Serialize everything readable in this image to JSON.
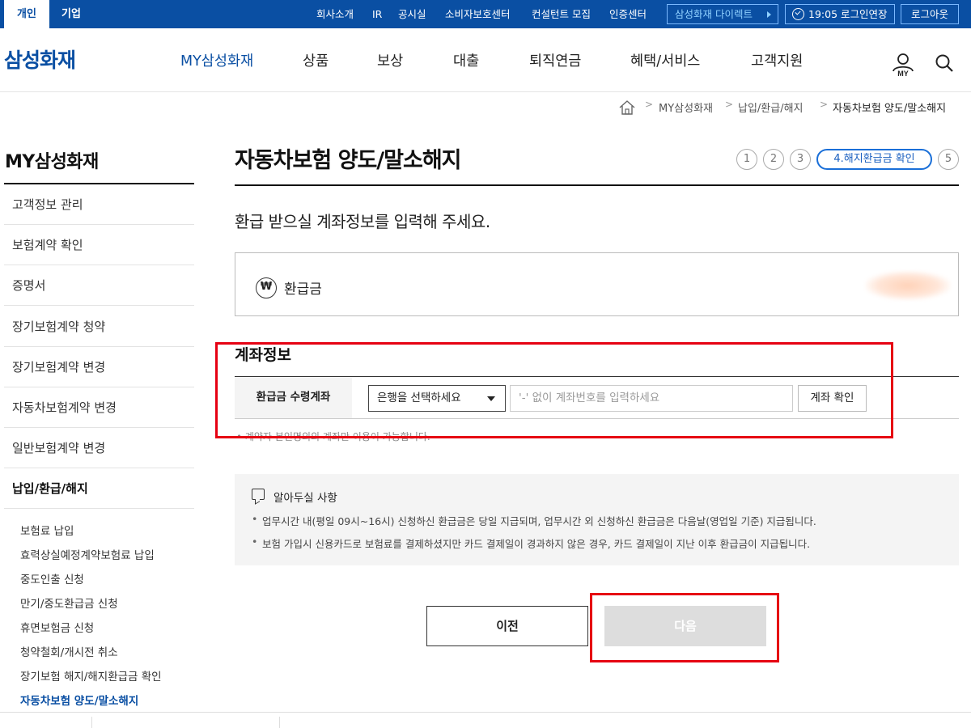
{
  "topbar": {
    "tab_personal": "개인",
    "tab_corporate": "기업",
    "links": [
      "회사소개",
      "IR",
      "공시실",
      "소비자보호센터",
      "컨설턴트 모집",
      "인증센터"
    ],
    "direct_button": "삼성화재 다이렉트",
    "login_extend": "19:05 로그인연장",
    "logout": "로그아웃"
  },
  "header": {
    "logo": "삼성화재",
    "menu": [
      "MY삼성화재",
      "상품",
      "보상",
      "대출",
      "퇴직연금",
      "혜택/서비스",
      "고객지원"
    ],
    "my_icon_label": "MY"
  },
  "breadcrumb": [
    "MY삼성화재",
    "납입/환급/해지",
    "자동차보험 양도/말소해지"
  ],
  "sidebar": {
    "title": "MY삼성화재",
    "items": [
      "고객정보 관리",
      "보험계약 확인",
      "증명서",
      "장기보험계약 청약",
      "장기보험계약 변경",
      "자동차보험계약 변경",
      "일반보험계약 변경",
      "납입/환급/해지"
    ],
    "sub_items": [
      "보험료 납입",
      "효력상실예정계약보험료 납입",
      "중도인출 신청",
      "만기/중도환급금 신청",
      "휴면보험금 신청",
      "청약철회/개시전 취소",
      "장기보험 해지/해지환급금 확인",
      "자동차보험 양도/말소해지"
    ]
  },
  "main": {
    "title": "자동차보험 양도/말소해지",
    "steps": [
      "1",
      "2",
      "3",
      "4.해지환급금 확인",
      "5"
    ],
    "intro": "환급 받으실 계좌정보를 입력해 주세요.",
    "refund_label": "환급금",
    "won_symbol": "₩",
    "account_section_title": "계좌정보",
    "account_row_label": "환급금 수령계좌",
    "bank_select_value": "은행을 선택하세요",
    "account_input_placeholder": "'-' 없이 계좌번호를 입력하세요",
    "account_confirm_button": "계좌 확인",
    "account_note": "• 계약자 본인명의의 계좌만 이용이 가능합니다.",
    "notice_title": "알아두실 사항",
    "notice_items": [
      "업무시간 내(평일 09시~16시) 신청하신 환급금은 당일 지급되며, 업무시간 외 신청하신 환급금은 다음날(영업일 기준) 지급됩니다.",
      "보험 가입시 신용카드로 보험료를 결제하셨지만 카드 결제일이 경과하지 않은 경우, 카드 결제일이 지난 이후 환급금이 지급됩니다."
    ],
    "prev_button": "이전",
    "next_button": "다음"
  },
  "colors": {
    "brand_blue": "#0a4fa3",
    "highlight_red": "#e60012",
    "disabled_gray": "#dddddd"
  }
}
